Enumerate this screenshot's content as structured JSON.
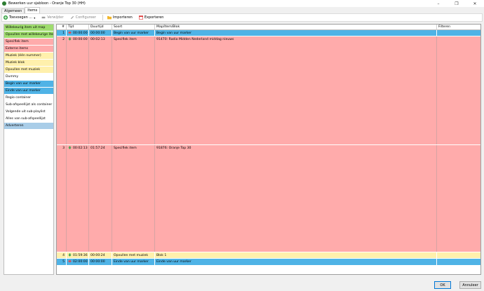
{
  "window": {
    "title": "Bewerken uur sjabloon - Oranje Top 30 (HH)",
    "controls": [
      "–",
      "❐",
      "✕"
    ]
  },
  "tabs": [
    {
      "label": "Algemeen",
      "active": false
    },
    {
      "label": "Items",
      "active": true
    }
  ],
  "toolbar": {
    "add_label": "Toevoegen ...",
    "delete_label": "Verwijder",
    "configure_label": "Configureer",
    "import_label": "Importeren",
    "export_label": "Exporteren"
  },
  "palette": [
    {
      "label": "Willekeurig item uit map",
      "color": "#9fdc6e"
    },
    {
      "label": "Opvullen met willekeurige items",
      "color": "#9fdc6e"
    },
    {
      "label": "Specifiek item",
      "color": "#ffabab"
    },
    {
      "label": "Externe items",
      "color": "#ffabab"
    },
    {
      "label": "Muziek (één nummer)",
      "color": "#fff0ac"
    },
    {
      "label": "Muziek blok",
      "color": "#fff0ac"
    },
    {
      "label": "Opvullen met muziek",
      "color": "#fff0ac"
    },
    {
      "label": "Dummy",
      "color": "#ffffff"
    },
    {
      "label": "Begin van uur marker",
      "color": "#4fb3e6"
    },
    {
      "label": "Einde van uur marker",
      "color": "#4fb3e6"
    },
    {
      "label": "Regio container",
      "color": "#ffffff"
    },
    {
      "label": "Sub-afspeellijst als container",
      "color": "#ffffff"
    },
    {
      "label": "Volgende uit sub-playlist",
      "color": "#ffffff"
    },
    {
      "label": "Alles van sub-afspeellijst",
      "color": "#ffffff"
    },
    {
      "label": "Adverteren",
      "color": "#a9cde8"
    }
  ],
  "grid": {
    "columns": [
      "#",
      "Tijd",
      "Duurtijd",
      "Soort",
      "Map/Item/Blok",
      "Filteren"
    ],
    "rows": [
      {
        "num": "1",
        "icon": "arrow-right-icon",
        "time": "00:00:00",
        "duration": "00:00:00",
        "type": "Begin van uur marker",
        "item": "Begin van uur marker",
        "filter": "",
        "color": "#4fb3e6"
      },
      {
        "num": "2",
        "icon": "arrow-down-icon",
        "time": "00:00:00",
        "duration": "00:02:13",
        "type": "Specifiek item",
        "item": "91470: Radio Midden Nederland middag nieuws",
        "filter": "",
        "color": "#ffabab"
      },
      {
        "num": "3",
        "icon": "arrow-down-icon",
        "time": "00:02:13",
        "duration": "01:57:24",
        "type": "Specifiek item",
        "item": "91876: Oranje Top 30",
        "filter": "",
        "color": "#ffabab"
      },
      {
        "num": "4",
        "icon": "arrow-down-icon",
        "time": "01:59:36",
        "duration": "00:00:24",
        "type": "Opvullen met muziek",
        "item": "Blok 1",
        "filter": "",
        "color": "#fff0ac"
      },
      {
        "num": "5",
        "icon": "arrow-right-icon",
        "time": "02:00:00",
        "duration": "00:00:00",
        "type": "Einde van uur marker",
        "item": "Einde van uur marker",
        "filter": "",
        "color": "#4fb3e6"
      }
    ]
  },
  "footer": {
    "ok_label": "OK",
    "cancel_label": "Annuleer"
  },
  "colors": {
    "accent": "#0078d7",
    "green": "#9fdc6e",
    "red": "#ffabab",
    "yellow": "#fff0ac",
    "blue": "#4fb3e6"
  }
}
